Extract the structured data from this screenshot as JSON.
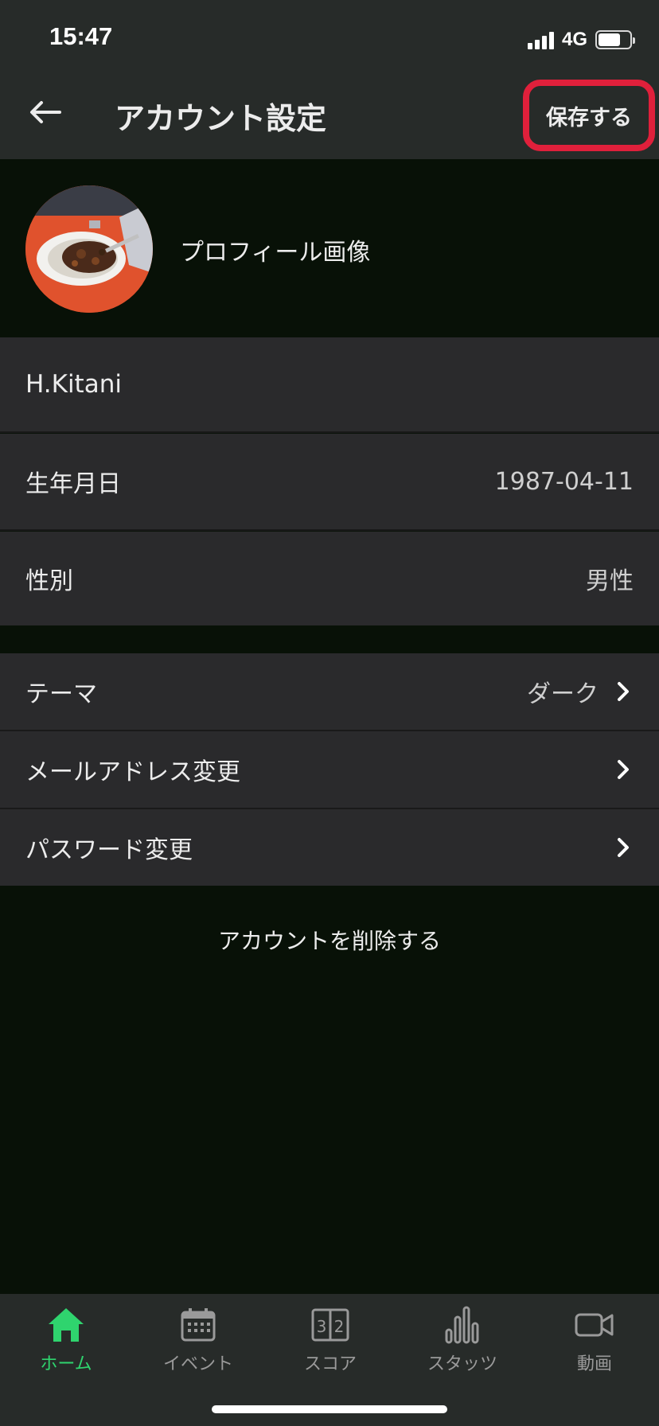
{
  "status_bar": {
    "time": "15:47",
    "network": "4G"
  },
  "header": {
    "title": "アカウント設定",
    "save_label": "保存する",
    "back_icon": "arrow-left-icon"
  },
  "profile": {
    "image_label": "プロフィール画像"
  },
  "fields": {
    "name": "H.Kitani",
    "birthday_label": "生年月日",
    "birthday_value": "1987-04-11",
    "gender_label": "性別",
    "gender_value": "男性"
  },
  "settings": {
    "theme_label": "テーマ",
    "theme_value": "ダーク",
    "email_label": "メールアドレス変更",
    "password_label": "パスワード変更"
  },
  "delete_label": "アカウントを削除する",
  "tabs": [
    {
      "label": "ホーム",
      "icon": "home-icon",
      "active": true
    },
    {
      "label": "イベント",
      "icon": "calendar-icon",
      "active": false
    },
    {
      "label": "スコア",
      "icon": "scoreboard-icon",
      "active": false
    },
    {
      "label": "スタッツ",
      "icon": "bar-chart-icon",
      "active": false
    },
    {
      "label": "動画",
      "icon": "video-camera-icon",
      "active": false
    }
  ],
  "colors": {
    "accent": "#2fd46e",
    "highlight": "#e0203b",
    "background": "#081107",
    "row": "#2a2a2c",
    "header": "#272b29"
  }
}
